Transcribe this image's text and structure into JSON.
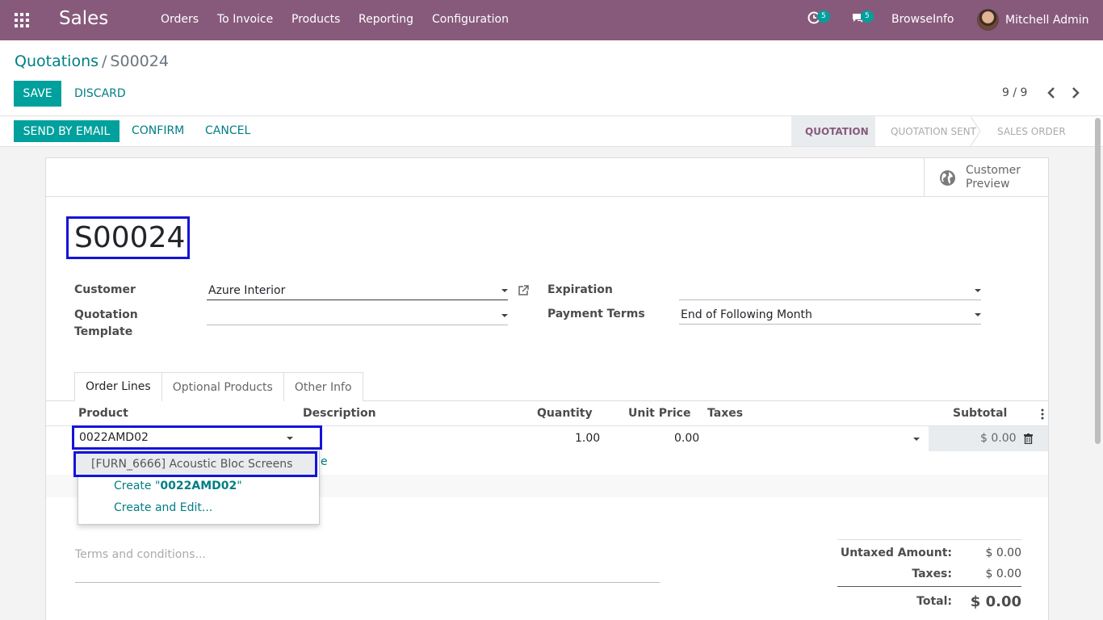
{
  "navbar": {
    "app_name": "Sales",
    "menu": [
      "Orders",
      "To Invoice",
      "Products",
      "Reporting",
      "Configuration"
    ],
    "activity_count": "5",
    "messages_count": "5",
    "company": "BrowseInfo",
    "user": "Mitchell Admin",
    "color": "#875a7b"
  },
  "control": {
    "breadcrumb_parent": "Quotations",
    "breadcrumb_sep": "/",
    "breadcrumb_current": "S00024",
    "save_label": "SAVE",
    "discard_label": "DISCARD",
    "pager": "9 / 9"
  },
  "statusbar": {
    "send_email_label": "SEND BY EMAIL",
    "confirm_label": "CONFIRM",
    "cancel_label": "CANCEL",
    "stages": [
      {
        "label": "QUOTATION",
        "active": true
      },
      {
        "label": "QUOTATION SENT",
        "active": false
      },
      {
        "label": "SALES ORDER",
        "active": false
      }
    ]
  },
  "sheet": {
    "customer_preview_line1": "Customer",
    "customer_preview_line2": "Preview",
    "name": "S00024",
    "customer_label": "Customer",
    "customer_value": "Azure Interior",
    "template_label_line1": "Quotation",
    "template_label_line2": "Template",
    "template_value": "",
    "expiration_label": "Expiration",
    "expiration_value": "",
    "payment_terms_label": "Payment Terms",
    "payment_terms_value": "End of Following Month"
  },
  "tabs": [
    "Order Lines",
    "Optional Products",
    "Other Info"
  ],
  "order_lines": {
    "columns": [
      "Product",
      "Description",
      "Quantity",
      "Unit Price",
      "Taxes",
      "Subtotal"
    ],
    "row": {
      "product_input": "0022AMD02",
      "quantity": "1.00",
      "unit_price": "0.00",
      "subtotal": "$ 0.00"
    },
    "partial_link_char": "e"
  },
  "autocomplete": {
    "match": "[FURN_6666] Acoustic Bloc Screens",
    "create_prefix": "Create \"",
    "create_term": "0022AMD02",
    "create_suffix": "\"",
    "create_edit": "Create and Edit..."
  },
  "terms_placeholder": "Terms and conditions...",
  "totals": {
    "untaxed_label": "Untaxed Amount:",
    "untaxed_value": "$ 0.00",
    "taxes_label": "Taxes:",
    "taxes_value": "$ 0.00",
    "total_label": "Total:",
    "total_value": "$ 0.00"
  },
  "colors": {
    "primary": "#00a09d",
    "link": "#017e84",
    "highlight_box": "#1414d8"
  }
}
